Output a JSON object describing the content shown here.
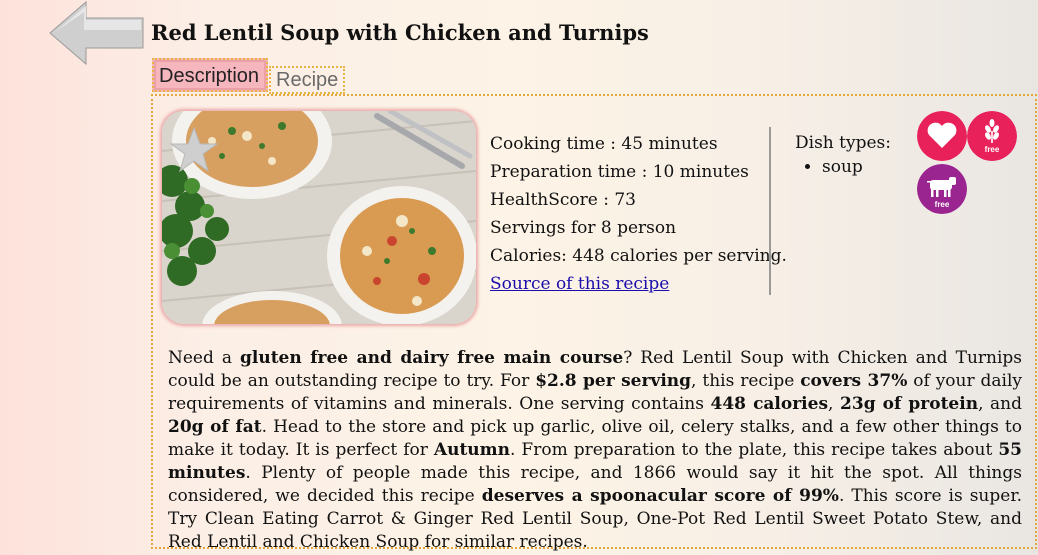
{
  "page": {
    "title": "Red Lentil Soup with Chicken and Turnips"
  },
  "tabs": [
    {
      "label": "Description",
      "active": true
    },
    {
      "label": "Recipe",
      "active": false
    }
  ],
  "facts": {
    "cooking_time": "Cooking time : 45 minutes",
    "prep_time": "Preparation time : 10 minutes",
    "health_score": "HealthScore : 73",
    "servings": "Servings for 8 person",
    "calories": "Calories: 448 calories per serving.",
    "source_link": "Source of this recipe"
  },
  "dish": {
    "label": "Dish types:",
    "types": [
      "soup"
    ]
  },
  "badges": {
    "gluten_free_label": "free",
    "dairy_free_label": "free"
  },
  "description": {
    "p1": "Need a ",
    "b1": "gluten free and dairy free main course",
    "p2": "? Red Lentil Soup with Chicken and Turnips could be an outstanding recipe to try. For ",
    "b2": "$2.8 per serving",
    "p3": ", this recipe ",
    "b3": "covers 37%",
    "p4": " of your daily requirements of vitamins and minerals. One serving contains ",
    "b4": "448 calories",
    "p5": ", ",
    "b5": "23g of protein",
    "p6": ", and ",
    "b6": "20g of fat",
    "p7": ". Head to the store and pick up garlic, olive oil, celery stalks, and a few other things to make it today. It is perfect for ",
    "b7": "Autumn",
    "p8": ". From preparation to the plate, this recipe takes about ",
    "b8": "55 minutes",
    "p9": ". Plenty of people made this recipe, and 1866 would say it hit the spot. All things considered, we decided this recipe ",
    "b9": "deserves a spoonacular score of 99%",
    "p10": ". This score is super. Try Clean Eating Carrot & Ginger Red Lentil Soup, One-Pot Red Lentil Sweet Potato Stew, and Red Lentil and Chicken Soup for similar recipes."
  },
  "colors": {
    "heart_badge": "#e8215a",
    "gluten_badge": "#e8215a",
    "dairy_badge": "#9b2590",
    "active_tab": "#f6b6be",
    "link": "#1a0dab"
  }
}
